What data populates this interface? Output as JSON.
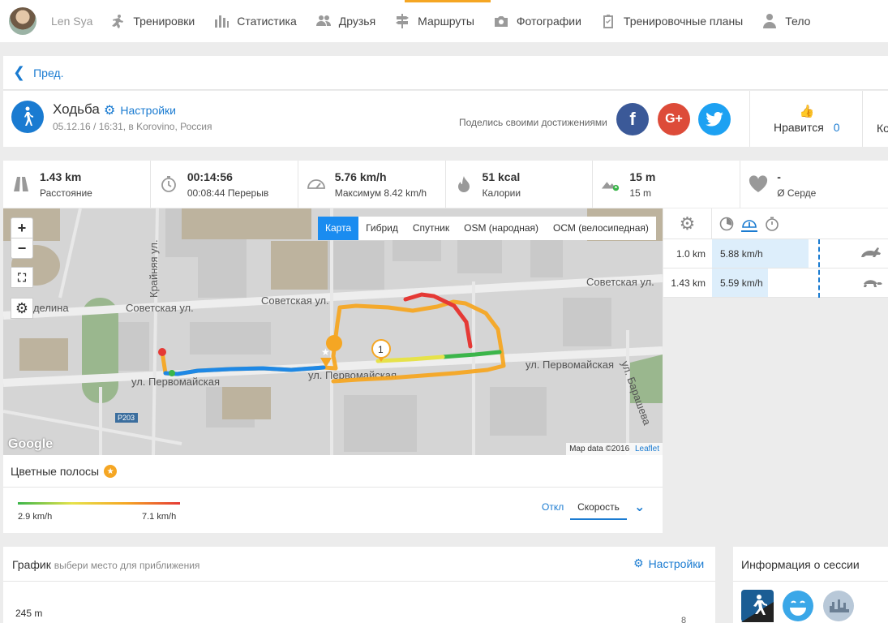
{
  "nav": {
    "username": "Len Sya",
    "items": [
      {
        "label": "Тренировки",
        "icon": "running-icon"
      },
      {
        "label": "Статистика",
        "icon": "bar-chart-icon"
      },
      {
        "label": "Друзья",
        "icon": "friends-icon"
      },
      {
        "label": "Маршруты",
        "icon": "signpost-icon"
      },
      {
        "label": "Фотографии",
        "icon": "camera-icon"
      },
      {
        "label": "Тренировочные планы",
        "icon": "clipboard-icon"
      },
      {
        "label": "Тело",
        "icon": "body-icon"
      }
    ]
  },
  "back": {
    "label": "Пред."
  },
  "activity": {
    "title": "Ходьба",
    "settings_label": "Настройки",
    "subtitle": "05.12.16 / 16:31, в Korovino, Россия",
    "share_label": "Поделись своими достижениями",
    "share_google_text": "G+",
    "like_label": "Нравится",
    "like_count": "0",
    "comment_label": "Ко"
  },
  "stats": [
    {
      "value": "1.43 km",
      "label": "Расстояние",
      "icon": "road-icon"
    },
    {
      "value": "00:14:56",
      "label": "00:08:44 Перерыв",
      "icon": "stopwatch-icon"
    },
    {
      "value": "5.76 km/h",
      "label": "Максимум 8.42 km/h",
      "icon": "speedometer-icon"
    },
    {
      "value": "51 kcal",
      "label": "Калории",
      "icon": "flame-icon"
    },
    {
      "value": "15 m",
      "label": "15 m",
      "icon": "elevation-icon"
    },
    {
      "value": "-",
      "label": "Ø Серде",
      "icon": "heart-icon"
    }
  ],
  "map": {
    "zoom_in": "+",
    "zoom_out": "−",
    "tabs": [
      "Карта",
      "Гибрид",
      "Спутник",
      "OSM (народная)",
      "ОСМ (велосипедная)"
    ],
    "active_tab": "Карта",
    "streets": [
      "Советская ул.",
      "Советская ул.",
      "Советская ул.",
      "ул. Первомайская",
      "ул. Первомайская",
      "ул. Первомайская",
      "Крайняя ул.",
      "ул. Барашева",
      "еделина",
      "Р203"
    ],
    "marker_label": "1",
    "google_label": "Google",
    "attribution": "Map data ©2016",
    "leaflet": "Leaflet"
  },
  "splits": {
    "rows": [
      {
        "distance": "1.0 km",
        "speed": "5.88 km/h",
        "fill": 0.55,
        "marker": "rabbit-icon"
      },
      {
        "distance": "1.43 km",
        "speed": "5.59 km/h",
        "fill": 0.32,
        "marker": "turtle-icon"
      }
    ]
  },
  "legend": {
    "title": "Цветные полосы",
    "min": "2.9 km/h",
    "max": "7.1 km/h",
    "off_label": "Откл",
    "mode_label": "Скорость"
  },
  "graph": {
    "title": "График",
    "hint": "выбери место для приближения",
    "settings_label": "Настройки",
    "y_max": "245 m",
    "right_num": "8"
  },
  "session": {
    "title": "Информация о сессии"
  },
  "colors": {
    "accent": "#1a7bd1",
    "nav_highlight": "#f5a623",
    "facebook": "#3b5998",
    "google": "#dd4b39",
    "twitter": "#1da1f2"
  }
}
